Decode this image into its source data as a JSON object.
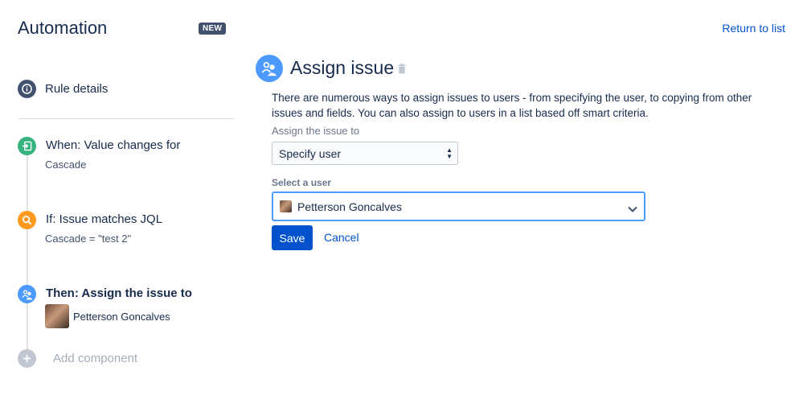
{
  "header": {
    "title": "Automation",
    "badge": "NEW",
    "return_link": "Return to list"
  },
  "sidebar": {
    "rule_details": "Rule details",
    "steps": [
      {
        "title": "When: Value changes for",
        "subtitle": "Cascade",
        "icon": "trigger-icon",
        "color": "#36b37e"
      },
      {
        "title": "If: Issue matches JQL",
        "subtitle": "Cascade = \"test 2\"",
        "icon": "search-icon",
        "color": "#ff991f"
      },
      {
        "title": "Then: Assign the issue to",
        "user": "Petterson Goncalves",
        "icon": "assign-user-icon",
        "color": "#4c9aff"
      }
    ],
    "add_component": "Add component"
  },
  "main": {
    "title": "Assign issue",
    "description": "There are numerous ways to assign issues to users - from specifying the user, to copying from other issues and fields. You can also assign to users in a list based off smart criteria.",
    "assign_label": "Assign the issue to",
    "assign_value": "Specify user",
    "select_user_label": "Select a user",
    "selected_user": "Petterson Goncalves",
    "save_label": "Save",
    "cancel_label": "Cancel"
  },
  "colors": {
    "primary": "#0052cc",
    "focus": "#4c9aff",
    "text": "#172b4d"
  }
}
